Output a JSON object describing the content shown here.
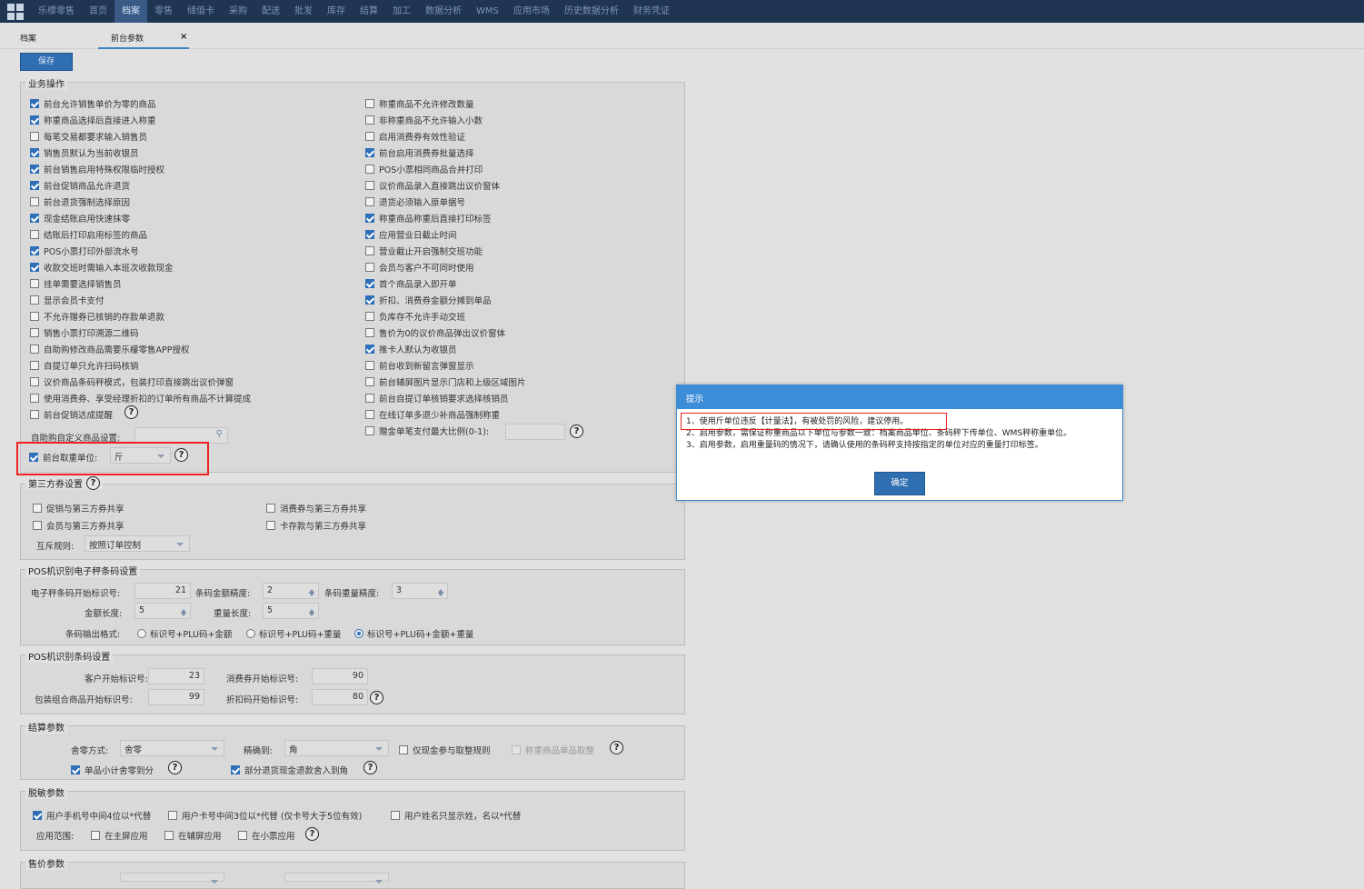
{
  "nav": {
    "items": [
      "乐檬零售",
      "首页",
      "档案",
      "零售",
      "储值卡",
      "采购",
      "配送",
      "批发",
      "库存",
      "结算",
      "加工",
      "数据分析",
      "WMS",
      "应用市场",
      "历史数据分析",
      "财务凭证"
    ],
    "active_index": 2
  },
  "tabs": {
    "first": "档案",
    "second": "前台参数",
    "close": "×"
  },
  "toolbar": {
    "save_label": "保存"
  },
  "business": {
    "legend": "业务操作",
    "left": [
      {
        "label": "前台允许销售单价为零的商品",
        "checked": true
      },
      {
        "label": "称重商品选择后直接进入称重",
        "checked": true
      },
      {
        "label": "每笔交易都要求输入销售员",
        "checked": false
      },
      {
        "label": "销售员默认为当前收银员",
        "checked": true
      },
      {
        "label": "前台销售启用特殊权限临时授权",
        "checked": true
      },
      {
        "label": "前台促销商品允许退货",
        "checked": true
      },
      {
        "label": "前台退货强制选择原因",
        "checked": false
      },
      {
        "label": "现金结账启用快速抹零",
        "checked": true
      },
      {
        "label": "结账后打印启用标签的商品",
        "checked": false
      },
      {
        "label": "POS小票打印外部流水号",
        "checked": true
      },
      {
        "label": "收款交班时需输入本班次收款现金",
        "checked": true
      },
      {
        "label": "挂单需要选择销售员",
        "checked": false
      },
      {
        "label": "显示会员卡支付",
        "checked": false
      },
      {
        "label": "不允许赠券已核销的存款单退款",
        "checked": false
      },
      {
        "label": "销售小票打印溯源二维码",
        "checked": false
      },
      {
        "label": "自助购修改商品需要乐檬零售APP授权",
        "checked": false
      },
      {
        "label": "自提订单只允许扫码核销",
        "checked": false
      },
      {
        "label": "议价商品条码秤模式，包装打印直接跳出议价弹窗",
        "checked": false
      },
      {
        "label": "使用消费券、享受经理折扣的订单所有商品不计算提成",
        "checked": false
      },
      {
        "label": "前台促销达成提醒",
        "checked": false
      }
    ],
    "right": [
      {
        "label": "称重商品不允许修改数量",
        "checked": false
      },
      {
        "label": "非称重商品不允许输入小数",
        "checked": false
      },
      {
        "label": "启用消费券有效性验证",
        "checked": false
      },
      {
        "label": "前台启用消费券批量选择",
        "checked": true
      },
      {
        "label": "POS小票相同商品合并打印",
        "checked": false
      },
      {
        "label": "议价商品录入直接跳出议价窗体",
        "checked": false
      },
      {
        "label": "退货必须输入原单据号",
        "checked": false
      },
      {
        "label": "称重商品称重后直接打印标签",
        "checked": true
      },
      {
        "label": "应用营业日截止时间",
        "checked": true
      },
      {
        "label": "营业截止开启强制交班功能",
        "checked": false
      },
      {
        "label": "会员与客户不可同时使用",
        "checked": false
      },
      {
        "label": "首个商品录入即开单",
        "checked": true
      },
      {
        "label": "折扣、消费券金额分摊到单品",
        "checked": true
      },
      {
        "label": "负库存不允许手动交班",
        "checked": false
      },
      {
        "label": "售价为0的议价商品弹出议价窗体",
        "checked": false
      },
      {
        "label": "推卡人默认为收银员",
        "checked": true
      },
      {
        "label": "前台收到新留言弹窗显示",
        "checked": false
      },
      {
        "label": "前台辅屏图片显示门店和上级区域图片",
        "checked": false
      },
      {
        "label": "前台自提订单核销要求选择核销员",
        "checked": false
      },
      {
        "label": "在线订单多退少补商品强制称重",
        "checked": false
      },
      {
        "label": "赠金单笔支付最大比例(0-1):",
        "checked": false
      }
    ],
    "self_service_label": "自助购自定义商品设置:",
    "weight_unit_label": "前台取重单位:",
    "weight_unit_value": "斤",
    "weight_unit_checked": true
  },
  "third_party": {
    "legend": "第三方券设置",
    "items": [
      {
        "label": "促销与第三方券共享",
        "checked": false
      },
      {
        "label": "消费券与第三方券共享",
        "checked": false
      },
      {
        "label": "会员与第三方券共享",
        "checked": false
      },
      {
        "label": "卡存款与第三方券共享",
        "checked": false
      }
    ],
    "rule_label": "互斥规则:",
    "rule_value": "按照订单控制"
  },
  "scale": {
    "legend": "POS机识别电子秤条码设置",
    "start_label": "电子秤条码开始标识号:",
    "start_value": "21",
    "amount_precision_label": "条码金额精度:",
    "amount_precision_value": "2",
    "weight_precision_label": "条码重量精度:",
    "weight_precision_value": "3",
    "amount_len_label": "金额长度:",
    "amount_len_value": "5",
    "weight_len_label": "重量长度:",
    "weight_len_value": "5",
    "format_label": "条码输出格式:",
    "formats": [
      "标识号+PLU码+金额",
      "标识号+PLU码+重量",
      "标识号+PLU码+金额+重量"
    ],
    "format_selected": 2
  },
  "barcode": {
    "legend": "POS机识别条码设置",
    "customer_label": "客户开始标识号:",
    "customer_value": "23",
    "coupon_label": "消费券开始标识号:",
    "coupon_value": "90",
    "package_label": "包装组合商品开始标识号:",
    "package_value": "99",
    "discount_label": "折扣码开始标识号:",
    "discount_value": "80"
  },
  "settlement": {
    "legend": "结算参数",
    "round_label": "舍零方式:",
    "round_value": "舍零",
    "precise_label": "精确到:",
    "precise_value": "角",
    "cash_only_label": "仅现金参与取整规则",
    "weighted_label": "称重商品单品取整",
    "item_subtotal_label": "单品小计舍零到分",
    "refund_label": "部分退货现金退款舍入到角"
  },
  "desens": {
    "legend": "脱敏参数",
    "phone_label": "用户手机号中间4位以*代替",
    "card_label": "用户卡号中间3位以*代替 (仅卡号大于5位有效)",
    "name_label": "用户姓名只显示姓，名以*代替",
    "scope_label": "应用范围:",
    "main_label": "在主屏应用",
    "aux_label": "在辅屏应用",
    "ticket_label": "在小票应用"
  },
  "price": {
    "legend": "售价参数"
  },
  "help_glyph": "?",
  "dialog": {
    "title": "提示",
    "line1": "1、使用斤单位违反【计量法】，有被处罚的风险，建议停用。",
    "line2": "2、启用参数，需保证称重商品以下单位与参数一致：档案商品单位、条码秤下传单位、WMS秤称重单位。",
    "line3": "3、启用参数，启用重量码的情况下，请确认使用的条码秤支持按指定的单位对应的重量打印标签。",
    "ok_label": "确定"
  }
}
